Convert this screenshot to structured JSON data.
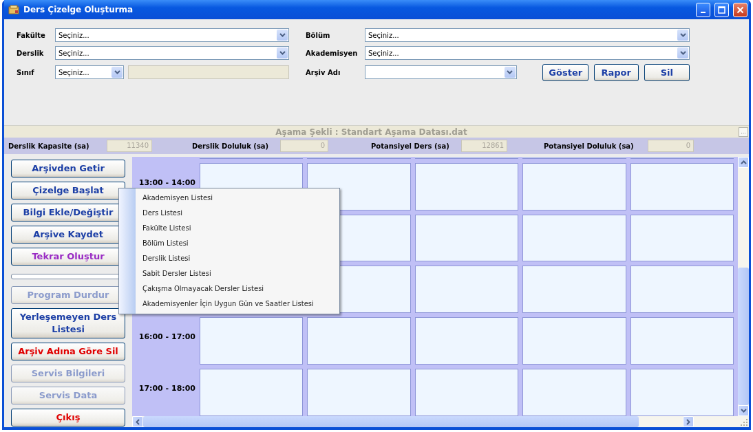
{
  "window": {
    "title": "Ders Çizelge Oluşturma"
  },
  "filters": {
    "left": [
      {
        "label": "Fakülte",
        "value": "Seçiniz..."
      },
      {
        "label": "Derslik",
        "value": "Seçiniz..."
      },
      {
        "label": "Sınıf",
        "value": "Seçiniz..."
      }
    ],
    "right": [
      {
        "label": "Bölüm",
        "value": "Seçiniz..."
      },
      {
        "label": "Akademisyen",
        "value": "Seçiniz..."
      },
      {
        "label": "Arşiv Adı"
      }
    ],
    "buttons": [
      "Göster",
      "Rapor",
      "Sil"
    ]
  },
  "status_strip": {
    "text": "Aşama Şekli : Standart Aşama Datası.dat",
    "button": "..."
  },
  "stats": [
    {
      "label": "Derslik Kapasite (sa)",
      "value": "11340"
    },
    {
      "label": "Derslik Doluluk (sa)",
      "value": "0"
    },
    {
      "label": "Potansiyel Ders (sa)",
      "value": "12861"
    },
    {
      "label": "Potansiyel Doluluk (sa)",
      "value": "0"
    }
  ],
  "side_buttons": [
    {
      "kind": "button",
      "label": "Arşivden Getir",
      "color": "#1c3fa6",
      "disabled": false
    },
    {
      "kind": "button",
      "label": "Çizelge Başlat",
      "color": "#1c3fa6",
      "disabled": false
    },
    {
      "kind": "button",
      "label": "Bilgi Ekle/Değiştir",
      "color": "#1c3fa6",
      "disabled": false
    },
    {
      "kind": "button",
      "label": "Arşive Kaydet",
      "color": "#1c3fa6",
      "disabled": false
    },
    {
      "kind": "button",
      "label": "Tekrar Oluştur",
      "color": "#9a2cc4",
      "disabled": false
    },
    {
      "kind": "progress"
    },
    {
      "kind": "button",
      "label": "Program Durdur",
      "color": "#8c9ccc",
      "disabled": true
    },
    {
      "kind": "button",
      "label": "Yerleşemeyen Ders Listesi",
      "color": "#1c3fa6",
      "disabled": false
    },
    {
      "kind": "button",
      "label": "Arşiv Adına Göre Sil",
      "color": "#e00000",
      "disabled": false
    },
    {
      "kind": "button",
      "label": "Servis Bilgileri",
      "color": "#8c9ccc",
      "disabled": true
    },
    {
      "kind": "button",
      "label": "Servis Data",
      "color": "#8c9ccc",
      "disabled": true
    },
    {
      "kind": "button",
      "label": "Çıkış",
      "color": "#e00000",
      "disabled": false
    }
  ],
  "schedule": {
    "rows": [
      {
        "time": "13:00 - 14:00"
      },
      {},
      {},
      {
        "time": "16:00 - 17:00"
      },
      {
        "time": "17:00 - 18:00"
      }
    ]
  },
  "context_menu": [
    "Akademisyen Listesi",
    "Ders Listesi",
    "Fakülte Listesi",
    "Bölüm Listesi",
    "Derslik Listesi",
    "Sabit Dersler Listesi",
    "Çakışma Olmayacak Dersler Listesi",
    "Akademisyenler İçin Uygun Gün ve Saatler Listesi"
  ]
}
